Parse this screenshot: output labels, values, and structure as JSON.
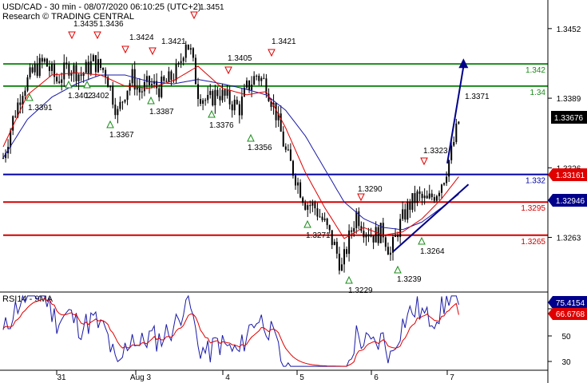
{
  "header": {
    "instrument_line": "USD/CAD - 30 min - 08/07/2020 06:10:25 (UTC+2)",
    "source_line": "Research © TRADING CENTRAL"
  },
  "rsi_panel": {
    "label": "RSI14 - 9MA",
    "ticks": [
      "70",
      "50",
      "30"
    ],
    "value_tag": "75.4154",
    "ma_tag": "66.6768"
  },
  "colors": {
    "candles": "#000000",
    "fast_ma": "#e00000",
    "slow_ma": "#1a1aa8",
    "resistance": "#1a8c1a",
    "pivot": "#0000aa",
    "support": "#d40000",
    "arrow": "#00008b",
    "price_tag": "#000000",
    "red_tag": "#e00000",
    "blue_tag": "#00008b"
  },
  "levels": [
    {
      "kind": "resistance",
      "value": 1.342,
      "label": "1.342"
    },
    {
      "kind": "resistance",
      "value": 1.34,
      "label": "1.34"
    },
    {
      "kind": "pivot",
      "value": 1.332,
      "label": "1.332"
    },
    {
      "kind": "support",
      "value": 1.3295,
      "label": "1.3295"
    },
    {
      "kind": "support",
      "value": 1.3265,
      "label": "1.3265"
    }
  ],
  "price_tags": {
    "last": "1.33676",
    "red": "1.33161",
    "blue": "1.32946"
  },
  "chart_data": {
    "type": "candlestick",
    "instrument": "USD/CAD",
    "timeframe": "30 min",
    "y_axis_ticks": [
      1.3452,
      1.3389,
      1.3326,
      1.3263
    ],
    "ylim": [
      1.3215,
      1.3475
    ],
    "x_axis_labels": [
      "31",
      "Aug 3",
      "4",
      "5",
      "6",
      "7"
    ],
    "annotations": {
      "highs": [
        "1.3435",
        "1.3436",
        "1.3424",
        "1.3421",
        "1.3451",
        "1.3405",
        "1.3421",
        "1.3290",
        "1.3323",
        "1.3371"
      ],
      "lows": [
        "1.3391",
        "1.3402",
        "1.3402",
        "1.3367",
        "1.3387",
        "1.3376",
        "1.3356",
        "1.3271",
        "1.3229",
        "1.3239",
        "1.3264"
      ]
    },
    "close_path": [
      [
        0,
        1.3335
      ],
      [
        4,
        1.337
      ],
      [
        8,
        1.3398
      ],
      [
        13,
        1.3415
      ],
      [
        17,
        1.3422
      ],
      [
        22,
        1.3405
      ],
      [
        27,
        1.3418
      ],
      [
        32,
        1.341
      ],
      [
        37,
        1.3422
      ],
      [
        42,
        1.3413
      ],
      [
        47,
        1.3375
      ],
      [
        50,
        1.3395
      ],
      [
        53,
        1.3408
      ],
      [
        56,
        1.3395
      ],
      [
        60,
        1.3402
      ],
      [
        64,
        1.3398
      ],
      [
        68,
        1.3405
      ],
      [
        72,
        1.3415
      ],
      [
        75,
        1.3442
      ],
      [
        77,
        1.343
      ],
      [
        80,
        1.3395
      ],
      [
        84,
        1.3385
      ],
      [
        88,
        1.3395
      ],
      [
        92,
        1.3388
      ],
      [
        97,
        1.338
      ],
      [
        100,
        1.3398
      ],
      [
        104,
        1.341
      ],
      [
        108,
        1.3402
      ],
      [
        112,
        1.3375
      ],
      [
        116,
        1.334
      ],
      [
        120,
        1.3318
      ],
      [
        124,
        1.3295
      ],
      [
        128,
        1.329
      ],
      [
        132,
        1.3275
      ],
      [
        136,
        1.3255
      ],
      [
        139,
        1.3235
      ],
      [
        142,
        1.3262
      ],
      [
        145,
        1.3285
      ],
      [
        148,
        1.3272
      ],
      [
        152,
        1.3265
      ],
      [
        156,
        1.3268
      ],
      [
        159,
        1.3248
      ],
      [
        162,
        1.327
      ],
      [
        166,
        1.329
      ],
      [
        170,
        1.33
      ],
      [
        174,
        1.3295
      ],
      [
        178,
        1.3305
      ],
      [
        181,
        1.3318
      ],
      [
        184,
        1.334
      ],
      [
        187,
        1.3368
      ]
    ],
    "fast_ma_path": [
      [
        0,
        1.3345
      ],
      [
        10,
        1.3392
      ],
      [
        20,
        1.341
      ],
      [
        30,
        1.3412
      ],
      [
        40,
        1.341
      ],
      [
        50,
        1.34
      ],
      [
        60,
        1.3398
      ],
      [
        70,
        1.3405
      ],
      [
        80,
        1.3418
      ],
      [
        90,
        1.3398
      ],
      [
        100,
        1.3392
      ],
      [
        108,
        1.3395
      ],
      [
        116,
        1.3362
      ],
      [
        124,
        1.3322
      ],
      [
        132,
        1.329
      ],
      [
        140,
        1.3262
      ],
      [
        148,
        1.3272
      ],
      [
        156,
        1.3265
      ],
      [
        164,
        1.3268
      ],
      [
        172,
        1.328
      ],
      [
        180,
        1.3298
      ],
      [
        187,
        1.3318
      ]
    ],
    "slow_ma_path": [
      [
        0,
        1.3335
      ],
      [
        10,
        1.337
      ],
      [
        20,
        1.339
      ],
      [
        30,
        1.3402
      ],
      [
        40,
        1.341
      ],
      [
        50,
        1.341
      ],
      [
        60,
        1.3404
      ],
      [
        70,
        1.3402
      ],
      [
        80,
        1.3406
      ],
      [
        90,
        1.3402
      ],
      [
        100,
        1.3397
      ],
      [
        108,
        1.3392
      ],
      [
        116,
        1.3378
      ],
      [
        124,
        1.3355
      ],
      [
        132,
        1.3325
      ],
      [
        140,
        1.3295
      ],
      [
        148,
        1.328
      ],
      [
        156,
        1.3272
      ],
      [
        164,
        1.327
      ],
      [
        172,
        1.3277
      ],
      [
        180,
        1.329
      ],
      [
        187,
        1.3302
      ]
    ],
    "projection": {
      "from": [
        181,
        1.333
      ],
      "to": [
        187,
        1.3425
      ]
    },
    "trendline": [
      [
        160,
        1.325
      ],
      [
        191,
        1.3311
      ]
    ],
    "rsi": {
      "ticks": [
        70,
        50,
        30
      ],
      "ylim": [
        20,
        85
      ],
      "last": 75.4154,
      "ma_last": 66.6768
    }
  }
}
